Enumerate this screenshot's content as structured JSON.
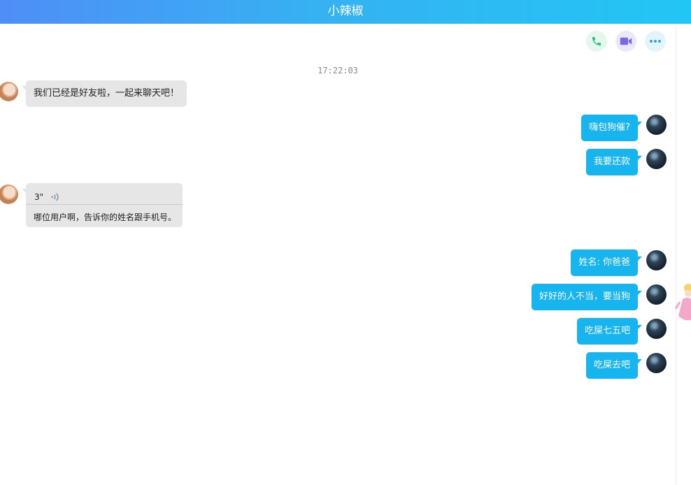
{
  "header": {
    "title": "小辣椒"
  },
  "toolbar": {
    "call_icon": "phone-icon",
    "video_icon": "video-camera-icon",
    "more_icon": "more-dots-icon"
  },
  "chat": {
    "timestamp": "17:22:03",
    "messages": [
      {
        "from": "contact",
        "text": "我们已经是好友啦，一起来聊天吧！"
      },
      {
        "from": "me",
        "text": "嗨包狗催?"
      },
      {
        "from": "me",
        "text": "我要还款"
      },
      {
        "from": "contact",
        "type": "voice",
        "duration": "3\"",
        "transcript": "哪位用户啊，告诉你的姓名跟手机号。"
      },
      {
        "from": "me",
        "text": "姓名: 你爸爸"
      },
      {
        "from": "me",
        "text": "好好的人不当，要当狗"
      },
      {
        "from": "me",
        "text": "吃屎七五吧"
      },
      {
        "from": "me",
        "text": "吃屎去吧"
      }
    ]
  },
  "colors": {
    "header_gradient_start": "#4f8ef7",
    "header_gradient_end": "#22c6f5",
    "my_bubble": "#16b5ef",
    "contact_bubble": "#e6e6e6"
  }
}
